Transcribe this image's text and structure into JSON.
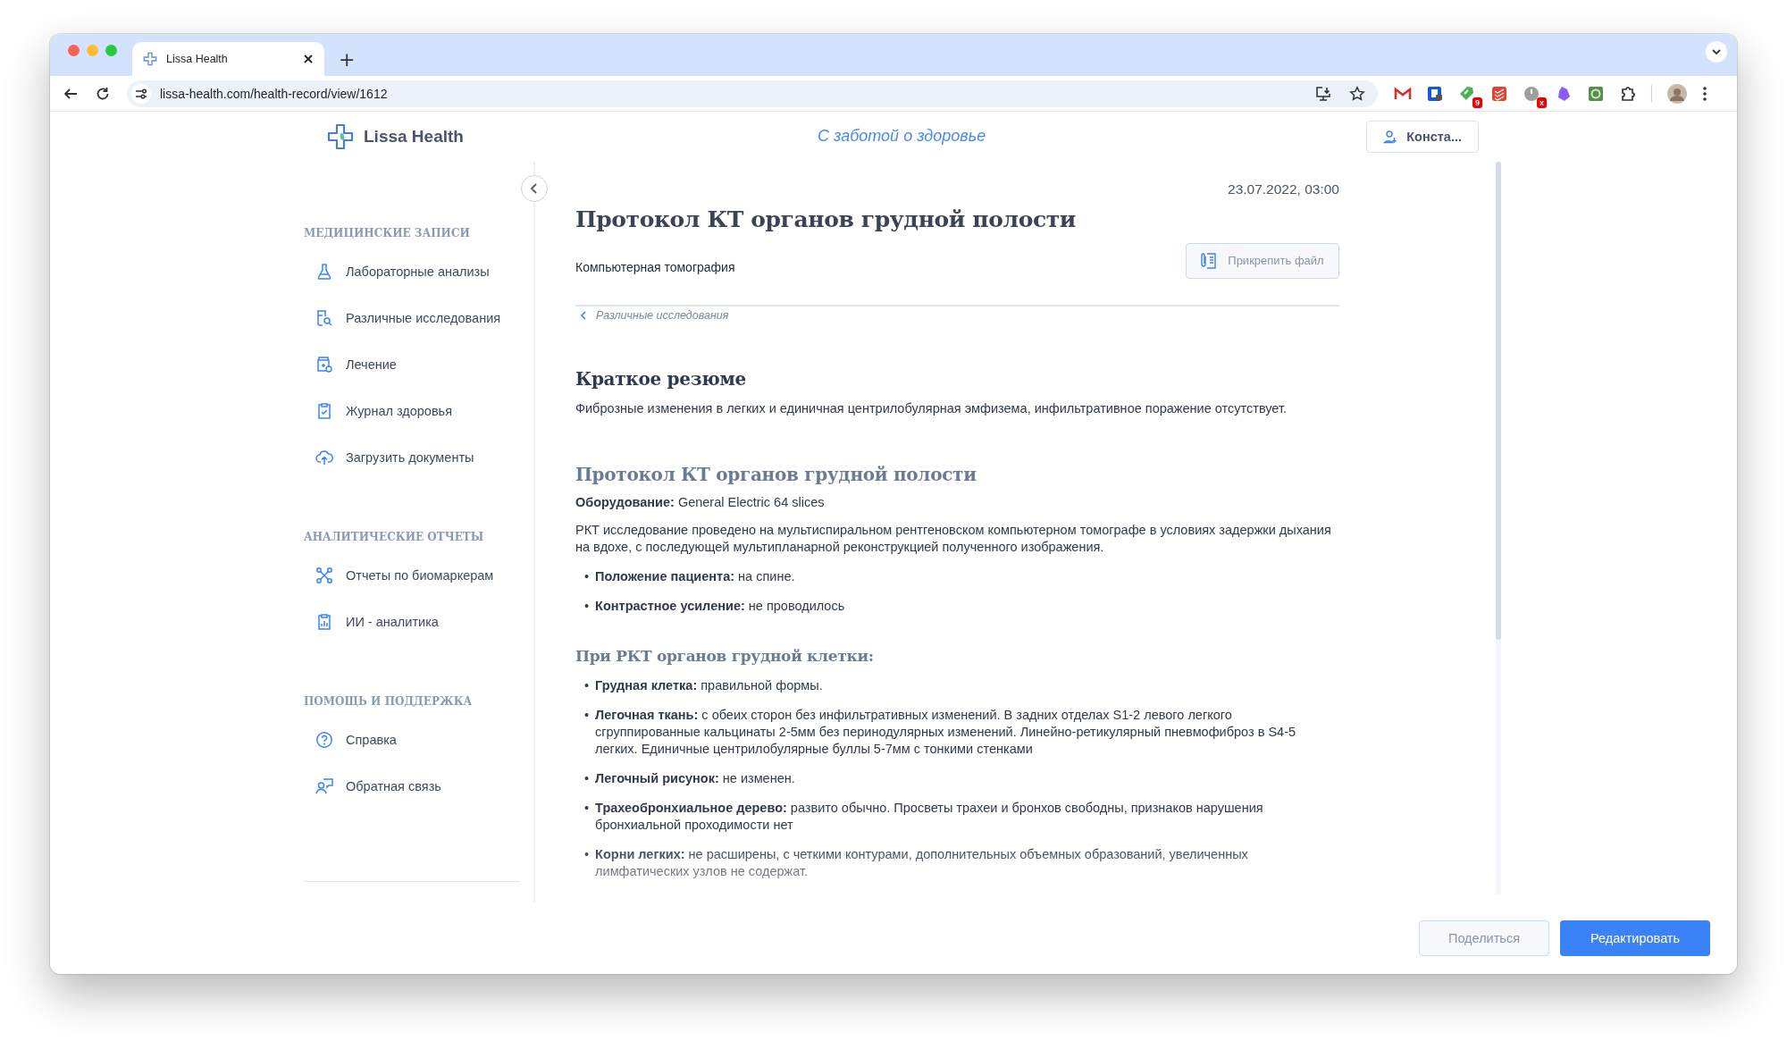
{
  "browser": {
    "tabs": [
      {
        "title": "Lissa Health",
        "selected": true
      }
    ],
    "new_tab": "+",
    "url": "lissa-health.com/health-record/view/1612",
    "extensions": [
      {
        "kind": "mail"
      },
      {
        "kind": "lock"
      },
      {
        "kind": "tag",
        "badge": "9"
      },
      {
        "kind": "stack"
      },
      {
        "kind": "power",
        "badge": "x"
      },
      {
        "kind": "crystal"
      },
      {
        "kind": "photo"
      },
      {
        "kind": "puzzle"
      }
    ]
  },
  "header": {
    "brand": "Lissa Health",
    "tagline": "С заботой о здоровье",
    "user_button": "Конста..."
  },
  "sidebar": {
    "sections": [
      {
        "title": "МЕДИЦИНСКИЕ ЗАПИСИ",
        "items": [
          {
            "label": "Лабораторные анализы",
            "kind": "flask",
            "selected": false
          },
          {
            "label": "Различные исследования",
            "kind": "tube",
            "selected": false
          },
          {
            "label": "Лечение",
            "kind": "jar",
            "selected": false
          },
          {
            "label": "Журнал здоровья",
            "kind": "clipboard",
            "selected": false
          },
          {
            "label": "Загрузить документы",
            "kind": "upload",
            "selected": false
          }
        ]
      },
      {
        "title": "АНАЛИТИЧЕСКИЕ ОТЧЕТЫ",
        "items": [
          {
            "label": "Отчеты по биомаркерам",
            "kind": "network",
            "selected": false
          },
          {
            "label": "ИИ - аналитика",
            "kind": "chart",
            "selected": false
          }
        ]
      },
      {
        "title": "ПОМОЩЬ И ПОДДЕРЖКА",
        "items": [
          {
            "label": "Справка",
            "kind": "help",
            "selected": false
          },
          {
            "label": "Обратная связь",
            "kind": "feedback",
            "selected": false
          }
        ]
      }
    ]
  },
  "record": {
    "date": "23.07.2022, 03:00",
    "title": "Протокол КТ органов грудной полости",
    "subtitle": "Компьютерная томография",
    "attach_button": "Прикрепить файл",
    "breadcrumb": "Различные исследования",
    "summary": {
      "heading": "Краткое резюме",
      "text": "Фиброзные изменения в легких и единичная центрилобулярная эмфизема, инфильтративное поражение отсутствует."
    },
    "protocol": {
      "heading": "Протокол КТ органов грудной полости",
      "equipment": "**Оборудование:** General Electric 64 slices",
      "paragraph": "РКТ исследование проведено на мультиспиральном рентгеновском компьютерном томографе в условиях задержки дыхания на вдохе, с последующей мультипланарной реконструкцией полученного изображения.",
      "bullets": [
        {
          "marker": "•",
          "text": "**Положение пациента:** на спине."
        },
        {
          "marker": "•",
          "text": "**Контрастное усиление:** не проводилось"
        }
      ],
      "subheading": "При РКТ органов грудной клетки:",
      "findings": [
        {
          "marker": "•",
          "text": "**Грудная клетка:** правильной формы."
        },
        {
          "marker": "•",
          "text": "**Легочная ткань:** с обеих сторон без инфильтративных изменений. В задних отделах S1-2 левого легкого сгруппированные кальцинаты 2-5мм без перинодулярных изменений. Линейно-ретикулярный пневмофиброз в S4-5 легких. Единичные центрилобулярные буллы 5-7мм с тонкими стенками"
        },
        {
          "marker": "•",
          "text": "**Легочный рисунок:** не изменен."
        },
        {
          "marker": "•",
          "text": "**Трахеобронхиальное дерево:** развито обычно. Просветы трахеи и бронхов свободны, признаков нарушения бронхиальной проходимости нет"
        },
        {
          "marker": "•",
          "text": "**Корни легких:** не расширены, с четкими контурами, дополнительных объемных образований, увеличенных лимфатических узлов не содержат."
        }
      ]
    }
  },
  "footer": {
    "share_button": "Поделиться",
    "edit_button": "Редактировать"
  }
}
